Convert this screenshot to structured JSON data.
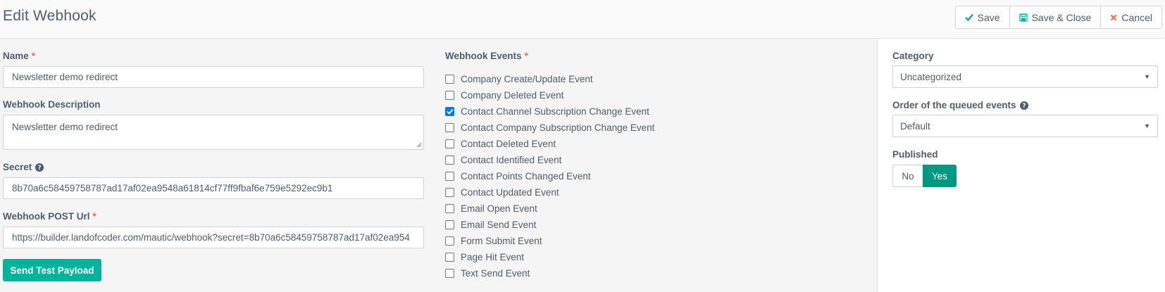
{
  "header": {
    "title": "Edit Webhook",
    "buttons": {
      "save": "Save",
      "save_close": "Save & Close",
      "cancel": "Cancel"
    }
  },
  "form": {
    "name": {
      "label": "Name",
      "required_mark": "*",
      "value": "Newsletter demo redirect"
    },
    "description": {
      "label": "Webhook Description",
      "value": "Newsletter demo redirect"
    },
    "secret": {
      "label": "Secret",
      "value": "8b70a6c58459758787ad17af02ea9548a61814cf77ff9fbaf6e759e5292ec9b1"
    },
    "post_url": {
      "label": "Webhook POST Url",
      "required_mark": "*",
      "value": "https://builder.landofcoder.com/mautic/webhook?secret=8b70a6c58459758787ad17af02ea954"
    },
    "send_test_label": "Send Test Payload"
  },
  "events": {
    "label": "Webhook Events",
    "required_mark": "*",
    "items": [
      {
        "label": "Company Create/Update Event",
        "checked": false
      },
      {
        "label": "Company Deleted Event",
        "checked": false
      },
      {
        "label": "Contact Channel Subscription Change Event",
        "checked": true
      },
      {
        "label": "Contact Company Subscription Change Event",
        "checked": false
      },
      {
        "label": "Contact Deleted Event",
        "checked": false
      },
      {
        "label": "Contact Identified Event",
        "checked": false
      },
      {
        "label": "Contact Points Changed Event",
        "checked": false
      },
      {
        "label": "Contact Updated Event",
        "checked": false
      },
      {
        "label": "Email Open Event",
        "checked": false
      },
      {
        "label": "Email Send Event",
        "checked": false
      },
      {
        "label": "Form Submit Event",
        "checked": false
      },
      {
        "label": "Page Hit Event",
        "checked": false
      },
      {
        "label": "Text Send Event",
        "checked": false
      }
    ]
  },
  "sidebar": {
    "category": {
      "label": "Category",
      "value": "Uncategorized"
    },
    "order": {
      "label": "Order of the queued events",
      "value": "Default"
    },
    "published": {
      "label": "Published",
      "no": "No",
      "yes": "Yes",
      "selected": "Yes"
    }
  },
  "colors": {
    "primary": "#00b49c",
    "toggle_active": "#00987f",
    "required": "#f86b4f",
    "checkbox_checked": "#0075ff"
  }
}
